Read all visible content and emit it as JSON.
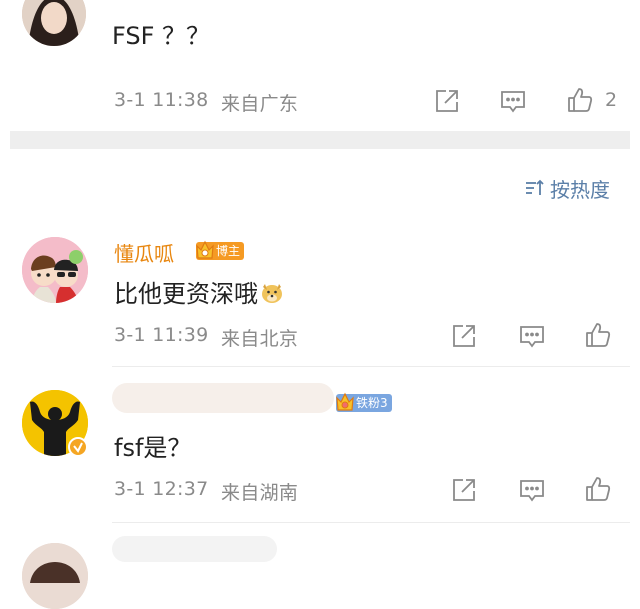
{
  "comments": [
    {
      "text": "FSF ？？",
      "time": "3-1 11:38",
      "location": "来自广东",
      "likes": "2"
    },
    {
      "name": "懂瓜呱",
      "badge": "博主",
      "text": "比他更资深哦",
      "emoji": "doge-emoji",
      "time": "3-1 11:39",
      "location": "来自北京"
    },
    {
      "badge": "铁粉3",
      "text": "fsf是？",
      "time": "3-1 12:37",
      "location": "来自湖南"
    }
  ],
  "sort": {
    "label": "按热度"
  },
  "colors": {
    "accent": "#e8860f",
    "badge_blogger": "#f59a23",
    "badge_fan": "#7aa6e0",
    "meta": "#8a8a8a"
  }
}
